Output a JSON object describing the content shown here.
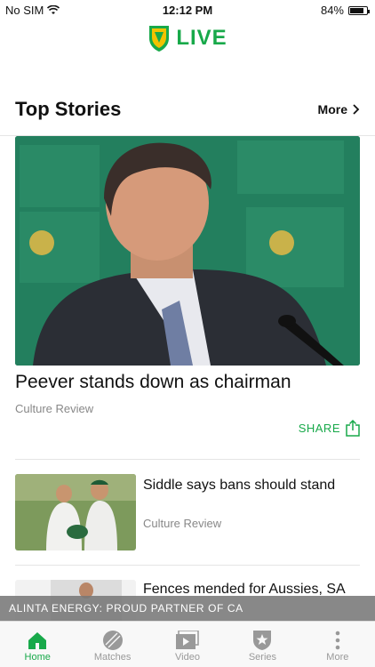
{
  "status_bar": {
    "carrier": "No SIM",
    "time": "12:12 PM",
    "battery": "84%",
    "battery_level": 0.84
  },
  "header": {
    "logo_text": "LIVE"
  },
  "section": {
    "title": "Top Stories",
    "more_label": "More"
  },
  "hero": {
    "title": "Peever stands down as chairman",
    "category": "Culture Review",
    "share_label": "SHARE"
  },
  "stories": [
    {
      "title": "Siddle says bans should stand",
      "category": "Culture Review"
    },
    {
      "title": "Fences mended for Aussies, SA",
      "category": ""
    }
  ],
  "sponsor": {
    "text": "ALINTA ENERGY: PROUD PARTNER OF CA"
  },
  "tabs": [
    {
      "label": "Home",
      "icon": "home-icon"
    },
    {
      "label": "Matches",
      "icon": "ball-icon"
    },
    {
      "label": "Video",
      "icon": "video-icon"
    },
    {
      "label": "Series",
      "icon": "star-shield-icon"
    },
    {
      "label": "More",
      "icon": "dots-icon"
    }
  ],
  "colors": {
    "accent": "#18a94a",
    "sponsor_bg": "#7a7a7a"
  }
}
